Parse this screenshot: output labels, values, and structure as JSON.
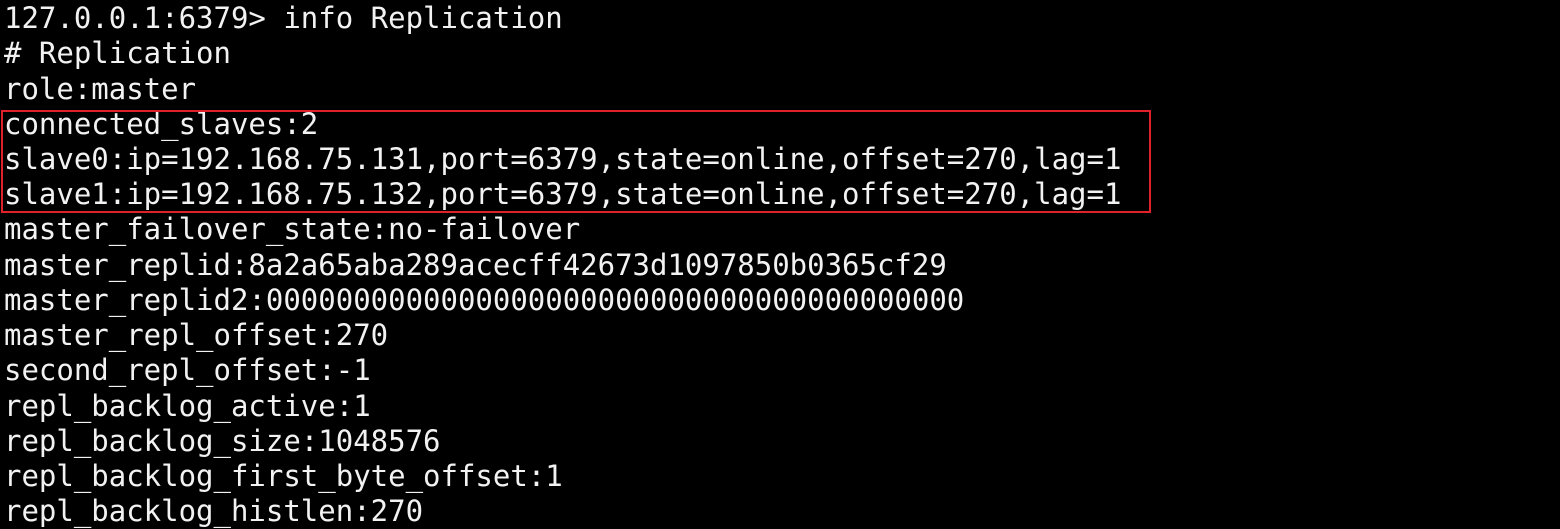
{
  "terminal": {
    "background": "#000000",
    "foreground": "#f2f2f2",
    "highlight_color": "#e0202a",
    "lines": [
      "127.0.0.1:6379> info Replication",
      "# Replication",
      "role:master",
      "connected_slaves:2",
      "slave0:ip=192.168.75.131,port=6379,state=online,offset=270,lag=1",
      "slave1:ip=192.168.75.132,port=6379,state=online,offset=270,lag=1",
      "master_failover_state:no-failover",
      "master_replid:8a2a65aba289acecff42673d1097850b0365cf29",
      "master_replid2:0000000000000000000000000000000000000000",
      "master_repl_offset:270",
      "second_repl_offset:-1",
      "repl_backlog_active:1",
      "repl_backlog_size:1048576",
      "repl_backlog_first_byte_offset:1",
      "repl_backlog_histlen:270"
    ]
  }
}
